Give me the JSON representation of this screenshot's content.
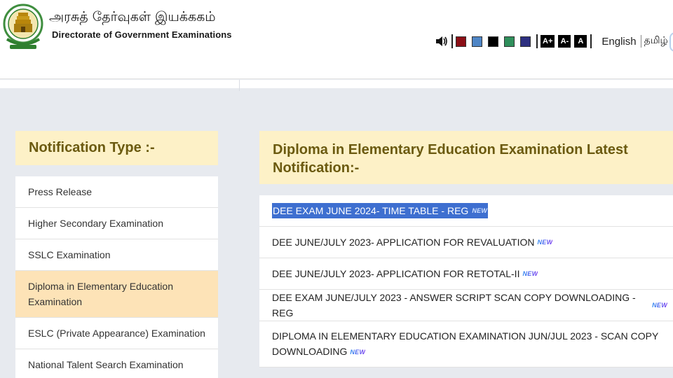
{
  "header": {
    "title_tamil": "அரசுத் தேர்வுகள் இயக்ககம்",
    "title_english": "Directorate of Government Examinations",
    "logo_icon": "tamilnadu-emblem-icon"
  },
  "accessibility": {
    "speaker_icon": "speaker-icon",
    "theme_colors": [
      "#8b0f16",
      "#4f86c6",
      "#000000",
      "#2f8f5b",
      "#2d2f80"
    ],
    "font_buttons": [
      "A+",
      "A-",
      "A"
    ],
    "lang_english": "English",
    "lang_tamil": "தமிழ்"
  },
  "sidebar": {
    "heading": "Notification Type :-",
    "items": [
      {
        "label": "Press Release"
      },
      {
        "label": "Higher Secondary Examination"
      },
      {
        "label": "SSLC Examination"
      },
      {
        "label": "Diploma in Elementary Education Examination",
        "active": true
      },
      {
        "label": "ESLC (Private Appearance) Examination"
      },
      {
        "label": "National Talent Search Examination"
      }
    ]
  },
  "main": {
    "heading": "Diploma in Elementary Education Examination Latest Notification:-",
    "new_badge": "NEW",
    "items": [
      {
        "label": "DEE EXAM JUNE 2024- TIME TABLE - REG",
        "selected": true
      },
      {
        "label": "DEE JUNE/JULY 2023- APPLICATION FOR REVALUATION"
      },
      {
        "label": "DEE JUNE/JULY 2023- APPLICATION FOR RETOTAL-II"
      },
      {
        "label": "DEE EXAM JUNE/JULY 2023 - ANSWER SCRIPT SCAN COPY DOWNLOADING - REG"
      },
      {
        "label": "DIPLOMA IN ELEMENTARY EDUCATION EXAMINATION JUN/JUL 2023 - SCAN COPY DOWNLOADING"
      }
    ]
  }
}
